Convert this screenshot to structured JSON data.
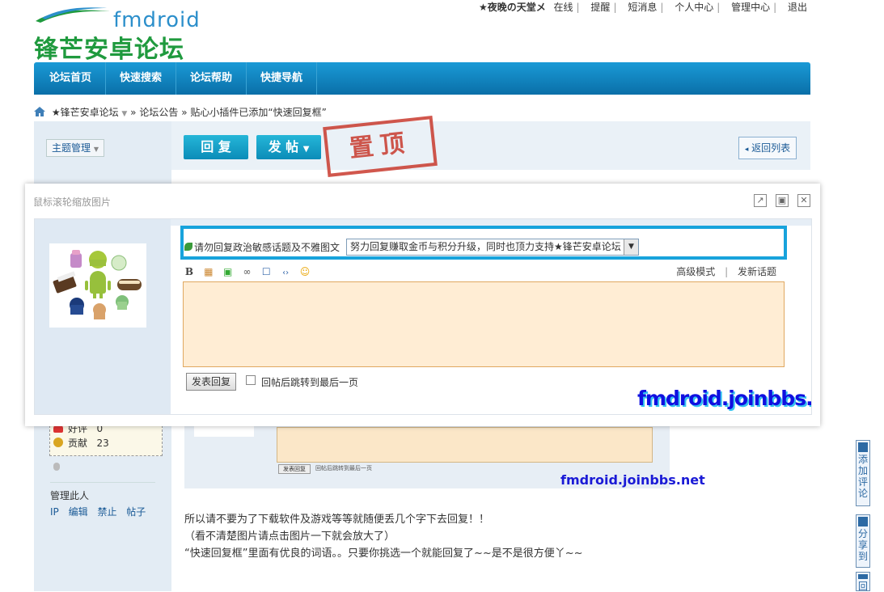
{
  "header": {
    "logo_en": "fmdroid",
    "logo_cn": "锋芒安卓论坛",
    "topbar": [
      "★夜晚の天堂メ",
      "在线",
      "提醒",
      "短消息",
      "个人中心",
      "管理中心",
      "退出"
    ]
  },
  "nav": [
    "论坛首页",
    "快速搜索",
    "论坛帮助",
    "快捷导航"
  ],
  "breadcrumb": {
    "site": "★锋芒安卓论坛",
    "forum": "论坛公告",
    "thread": "贴心小插件已添加“快速回复框”",
    "sep": "»"
  },
  "toolbar": {
    "reply": "回 复",
    "post": "发 帖",
    "pinned_stamp": "置顶",
    "back": "返回列表",
    "topic_manage": "主题管理"
  },
  "sidebar": {
    "credits": [
      {
        "label": "好评",
        "value": "0"
      },
      {
        "label": "贡献",
        "value": "23"
      }
    ],
    "manage_title": "管理此人",
    "manage_links": [
      "IP",
      "编辑",
      "禁止",
      "帖子"
    ]
  },
  "post_body": [
    "所以请不要为了下载软件及游戏等等就随便丢几个字下去回复！！",
    "（看不清楚图片请点击图片一下就会放大了）",
    "“快速回复框”里面有优良的词语。。只要你挑选一个就能回复了~~是不是很方便丫~~"
  ],
  "float_buttons": [
    "添加评论",
    "分享到",
    "回"
  ],
  "dialog": {
    "title": "鼠标滚轮缩放图片",
    "quick_reply_label": "请勿回复政治敏感话题及不雅图文",
    "quick_reply_selected": "努力回复赚取金币与积分升级，同时也顶力支持★锋芒安卓论坛",
    "editor_tools": [
      "B",
      "▦",
      "▣",
      "∞",
      "☐",
      "‹›",
      "☺"
    ],
    "advanced_mode": "高级模式",
    "new_topic": "发新话题",
    "adv_sep": "|",
    "submit": "发表回复",
    "jump_label": "回帖后跳转到最后一页",
    "watermark": "fmdroid.joinbbs.net"
  },
  "colors": {
    "nav_blue": "#0a6fa8",
    "highlight": "#18a3dc",
    "editor_bg": "#ffedd4",
    "stamp_red": "#c93a2e",
    "watermark": "#1010e0"
  }
}
